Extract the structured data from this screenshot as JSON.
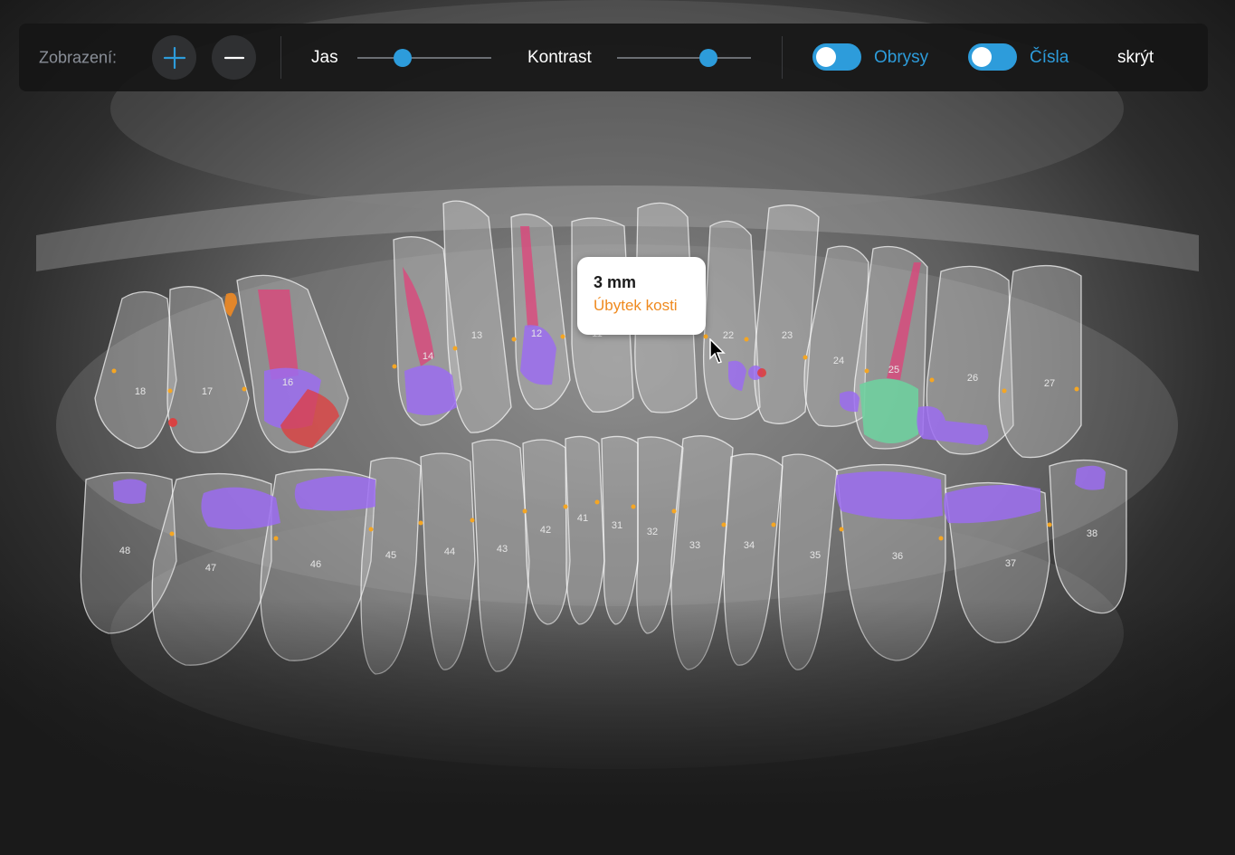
{
  "toolbar": {
    "view_label": "Zobrazení:",
    "zoom_in_icon": "plus-icon",
    "zoom_out_icon": "minus-icon",
    "brightness_label": "Jas",
    "brightness_value": 0.34,
    "contrast_label": "Kontrast",
    "contrast_value": 0.68,
    "outlines_label": "Obrysy",
    "outlines_on": false,
    "numbers_label": "Čísla",
    "numbers_on": false,
    "hide_label": "skrýt"
  },
  "tooltip": {
    "value": "3 mm",
    "title": "Úbytek kosti"
  },
  "teeth_upper": [
    "18",
    "17",
    "16",
    "14",
    "13",
    "12",
    "11",
    "22",
    "23",
    "24",
    "25",
    "26",
    "27"
  ],
  "teeth_lower": [
    "48",
    "47",
    "46",
    "45",
    "44",
    "43",
    "42",
    "41",
    "31",
    "32",
    "33",
    "34",
    "35",
    "36",
    "37",
    "38"
  ],
  "colors": {
    "accent": "#2d9cdb",
    "caries": "#9b6cf0",
    "root_canal": "#e0427a",
    "lesion_red": "#e23b3b",
    "healthy_mint": "#6fcf9f",
    "bone_marker": "#f5a623",
    "tooltip_title": "#ef8a1f"
  }
}
